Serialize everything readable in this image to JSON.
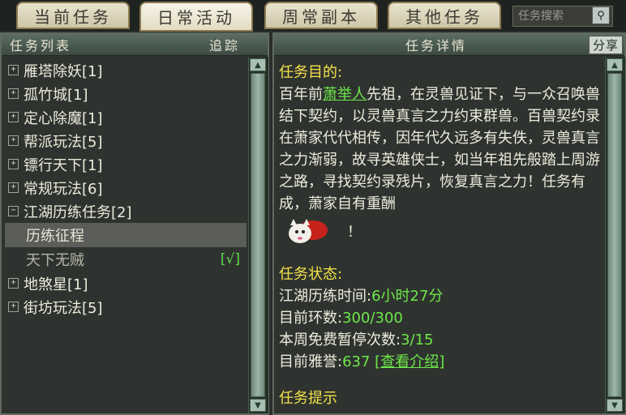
{
  "tabs": [
    "当前任务",
    "日常活动",
    "周常副本",
    "其他任务"
  ],
  "search": {
    "placeholder": "任务搜索"
  },
  "left_panel": {
    "title": "任务列表",
    "track_label": "追踪",
    "items": [
      {
        "label": "雁塔除妖[1]",
        "expander": "+"
      },
      {
        "label": "孤竹城[1]",
        "expander": "+"
      },
      {
        "label": "定心除魔[1]",
        "expander": "+"
      },
      {
        "label": "帮派玩法[5]",
        "expander": "+"
      },
      {
        "label": "镖行天下[1]",
        "expander": "+"
      },
      {
        "label": "常规玩法[6]",
        "expander": "+"
      },
      {
        "label": "江湖历练任务[2]",
        "expander": "−"
      }
    ],
    "subitems": [
      {
        "label": "历练征程"
      },
      {
        "label": "天下无贼",
        "status": "[√]"
      }
    ],
    "items_after": [
      {
        "label": "地煞星[1]",
        "expander": "+"
      },
      {
        "label": "街坊玩法[5]",
        "expander": "+"
      }
    ]
  },
  "right_panel": {
    "title": "任务详情",
    "share_label": "分享",
    "goal_heading": "任务目的:",
    "desc_before": "百年前",
    "desc_npc": "萧举人",
    "desc_after": "先祖，在灵兽见证下，与一众召唤兽结下契约，以灵兽真言之力约束群兽。百兽契约录在萧家代代相传，因年代久远多有失佚，灵兽真言之力渐弱，故寻英雄侠士，如当年祖先般踏上周游之路，寻找契约录残片，恢复真言之力！任务有成，萧家自有重酬",
    "desc_end": "！",
    "status_heading": "任务状态:",
    "status": {
      "time_label": "江湖历练时间:",
      "time_value": "6小时27分",
      "ring_label": "目前环数:",
      "ring_value": "300/300",
      "pause_label": "本周免费暂停次数:",
      "pause_value": "3/15",
      "prestige_label": "目前雅誉:",
      "prestige_value": "637",
      "view_intro": "[查看介绍]"
    },
    "hint_heading": "任务提示"
  }
}
